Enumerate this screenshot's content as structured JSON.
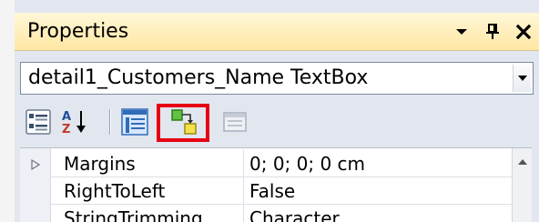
{
  "panel": {
    "title": "Properties",
    "title_icons": [
      "chevron-down-icon",
      "pin-icon",
      "close-icon"
    ]
  },
  "selector": {
    "value": "detail1_Customers_Name TextBox"
  },
  "toolbar": {
    "buttons": [
      "categorized-icon",
      "alphabetical-sort-icon",
      "properties-icon",
      "events-icon",
      "property-pages-icon"
    ],
    "highlight_color": "#e60012"
  },
  "grid": {
    "rows": [
      {
        "name": "Margins",
        "value": "0; 0; 0; 0 cm",
        "expandable": true
      },
      {
        "name": "RightToLeft",
        "value": "False",
        "expandable": false
      },
      {
        "name": "StringTrimming",
        "value": "Character",
        "expandable": false
      }
    ]
  },
  "colors": {
    "title_bar": "#ffe7a3",
    "panel_background": "#e2e6ee"
  }
}
